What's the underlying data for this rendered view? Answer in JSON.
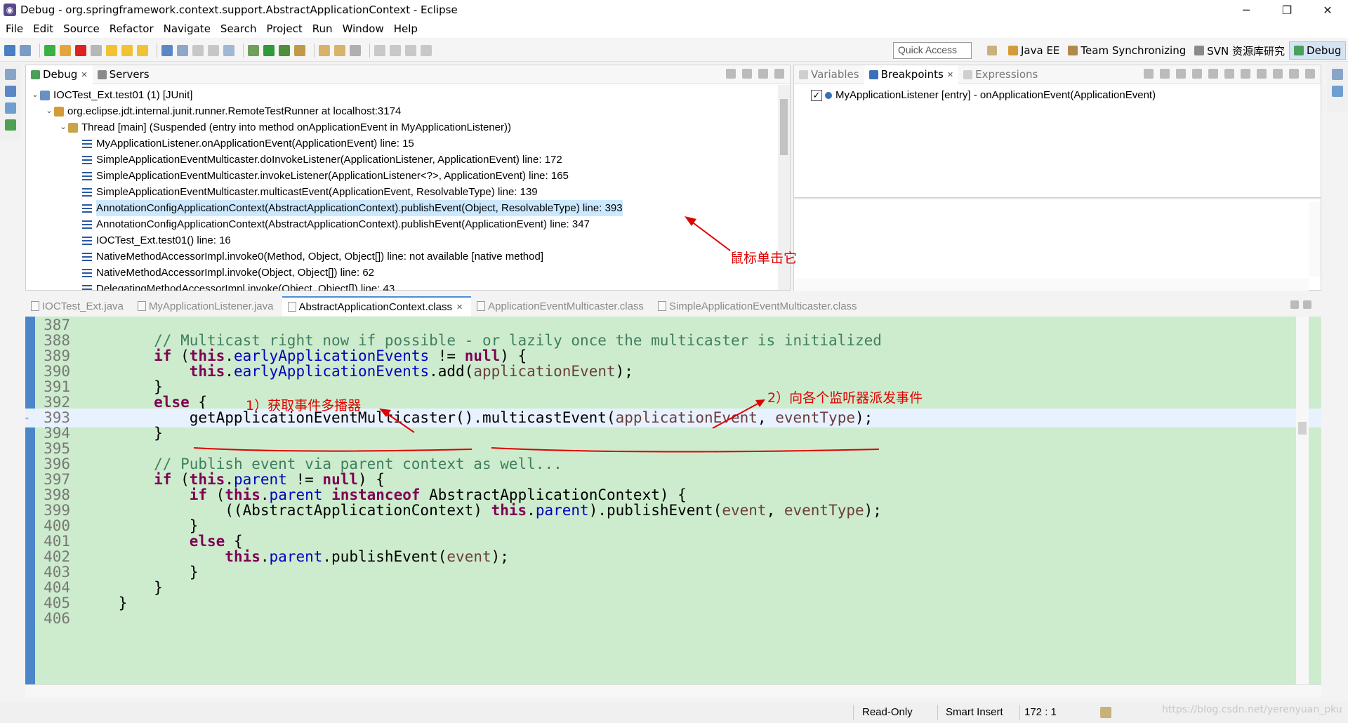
{
  "window": {
    "title": "Debug - org.springframework.context.support.AbstractApplicationContext - Eclipse",
    "minimize": "─",
    "restore": "❐",
    "close": "✕"
  },
  "menu": [
    "File",
    "Edit",
    "Source",
    "Refactor",
    "Navigate",
    "Search",
    "Project",
    "Run",
    "Window",
    "Help"
  ],
  "toolbar": {
    "quick_access_placeholder": "Quick Access",
    "perspectives": [
      "Java EE",
      "Team Synchronizing",
      "SVN 资源库研究",
      "Debug"
    ],
    "active_perspective": "Debug"
  },
  "debug_view": {
    "tabs": [
      {
        "label": "Debug",
        "icon": "debug-icon",
        "active": true
      },
      {
        "label": "Servers",
        "icon": "servers-icon",
        "active": false
      }
    ],
    "tree": [
      {
        "indent": 0,
        "arrow": "⌄",
        "icon": "junit-icon",
        "text": "IOCTest_Ext.test01 (1) [JUnit]"
      },
      {
        "indent": 1,
        "arrow": "⌄",
        "icon": "runner-icon",
        "text": "org.eclipse.jdt.internal.junit.runner.RemoteTestRunner at localhost:3174"
      },
      {
        "indent": 2,
        "arrow": "⌄",
        "icon": "thread-icon",
        "text": "Thread [main] (Suspended (entry into method onApplicationEvent in MyApplicationListener))"
      },
      {
        "indent": 3,
        "arrow": "",
        "icon": "stack-frame-icon",
        "text": "MyApplicationListener.onApplicationEvent(ApplicationEvent) line: 15"
      },
      {
        "indent": 3,
        "arrow": "",
        "icon": "stack-frame-icon",
        "text": "SimpleApplicationEventMulticaster.doInvokeListener(ApplicationListener, ApplicationEvent) line: 172"
      },
      {
        "indent": 3,
        "arrow": "",
        "icon": "stack-frame-icon",
        "text": "SimpleApplicationEventMulticaster.invokeListener(ApplicationListener<?>, ApplicationEvent) line: 165"
      },
      {
        "indent": 3,
        "arrow": "",
        "icon": "stack-frame-icon",
        "text": "SimpleApplicationEventMulticaster.multicastEvent(ApplicationEvent, ResolvableType) line: 139"
      },
      {
        "indent": 3,
        "arrow": "",
        "icon": "stack-frame-icon",
        "text": "AnnotationConfigApplicationContext(AbstractApplicationContext).publishEvent(Object, ResolvableType) line: 393",
        "selected": true
      },
      {
        "indent": 3,
        "arrow": "",
        "icon": "stack-frame-icon",
        "text": "AnnotationConfigApplicationContext(AbstractApplicationContext).publishEvent(ApplicationEvent) line: 347"
      },
      {
        "indent": 3,
        "arrow": "",
        "icon": "stack-frame-icon",
        "text": "IOCTest_Ext.test01() line: 16"
      },
      {
        "indent": 3,
        "arrow": "",
        "icon": "stack-frame-icon",
        "text": "NativeMethodAccessorImpl.invoke0(Method, Object, Object[]) line: not available [native method]"
      },
      {
        "indent": 3,
        "arrow": "",
        "icon": "stack-frame-icon",
        "text": "NativeMethodAccessorImpl.invoke(Object, Object[]) line: 62"
      },
      {
        "indent": 3,
        "arrow": "",
        "icon": "stack-frame-icon",
        "text": "DelegatingMethodAccessorImpl.invoke(Object, Object[]) line: 43"
      }
    ]
  },
  "breakpoints_view": {
    "tabs": [
      {
        "label": "Variables",
        "active": false
      },
      {
        "label": "Breakpoints",
        "active": true
      },
      {
        "label": "Expressions",
        "active": false
      }
    ],
    "items": [
      {
        "checked": true,
        "text": "MyApplicationListener [entry] - onApplicationEvent(ApplicationEvent)"
      }
    ]
  },
  "editor": {
    "tabs": [
      {
        "label": "IOCTest_Ext.java",
        "active": false
      },
      {
        "label": "MyApplicationListener.java",
        "active": false
      },
      {
        "label": "AbstractApplicationContext.class",
        "active": true
      },
      {
        "label": "ApplicationEventMulticaster.class",
        "active": false
      },
      {
        "label": "SimpleApplicationEventMulticaster.class",
        "active": false
      }
    ],
    "current_line": "393",
    "lines": [
      {
        "n": "387",
        "html": ""
      },
      {
        "n": "388",
        "html": "        <span class=\"cm\">// Multicast right now if possible - or lazily once the multicaster is initialized</span>"
      },
      {
        "n": "389",
        "html": "        <span class=\"kw\">if</span> (<span class=\"kw\">this</span>.<span class=\"fld\">earlyApplicationEvents</span> != <span class=\"kw\">null</span>) {"
      },
      {
        "n": "390",
        "html": "            <span class=\"kw\">this</span>.<span class=\"fld\">earlyApplicationEvents</span>.add(<span class=\"pm\">applicationEvent</span>);"
      },
      {
        "n": "391",
        "html": "        }"
      },
      {
        "n": "392",
        "html": "        <span class=\"kw\">else</span> {"
      },
      {
        "n": "393",
        "html": "            getApplicationEventMulticaster().multicastEvent(<span class=\"pm\">applicationEvent</span>, <span class=\"pm\">eventType</span>);"
      },
      {
        "n": "394",
        "html": "        }"
      },
      {
        "n": "395",
        "html": ""
      },
      {
        "n": "396",
        "html": "        <span class=\"cm\">// Publish event via parent context as well...</span>"
      },
      {
        "n": "397",
        "html": "        <span class=\"kw\">if</span> (<span class=\"kw\">this</span>.<span class=\"fld\">parent</span> != <span class=\"kw\">null</span>) {"
      },
      {
        "n": "398",
        "html": "            <span class=\"kw\">if</span> (<span class=\"kw\">this</span>.<span class=\"fld\">parent</span> <span class=\"kw\">instanceof</span> AbstractApplicationContext) {"
      },
      {
        "n": "399",
        "html": "                ((AbstractApplicationContext) <span class=\"kw\">this</span>.<span class=\"fld\">parent</span>).publishEvent(<span class=\"pm\">event</span>, <span class=\"pm\">eventType</span>);"
      },
      {
        "n": "400",
        "html": "            }"
      },
      {
        "n": "401",
        "html": "            <span class=\"kw\">else</span> {"
      },
      {
        "n": "402",
        "html": "                <span class=\"kw\">this</span>.<span class=\"fld\">parent</span>.publishEvent(<span class=\"pm\">event</span>);"
      },
      {
        "n": "403",
        "html": "            }"
      },
      {
        "n": "404",
        "html": "        }"
      },
      {
        "n": "405",
        "html": "    }"
      },
      {
        "n": "406",
        "html": ""
      }
    ]
  },
  "annotations": {
    "click_it": "鼠标单击它",
    "step1": "1）获取事件多播器",
    "step2": "2）向各个监听器派发事件",
    "color": "#e00000"
  },
  "status": {
    "mode": "Read-Only",
    "insert": "Smart Insert",
    "position": "172 : 1"
  },
  "watermark": "https://blog.csdn.net/yerenyuan_pku",
  "colors": {
    "editor_bg": "#cdeccd",
    "selection": "#cce8ff",
    "keyword": "#7f0055",
    "field": "#0000c0",
    "comment": "#3f7f5f"
  }
}
